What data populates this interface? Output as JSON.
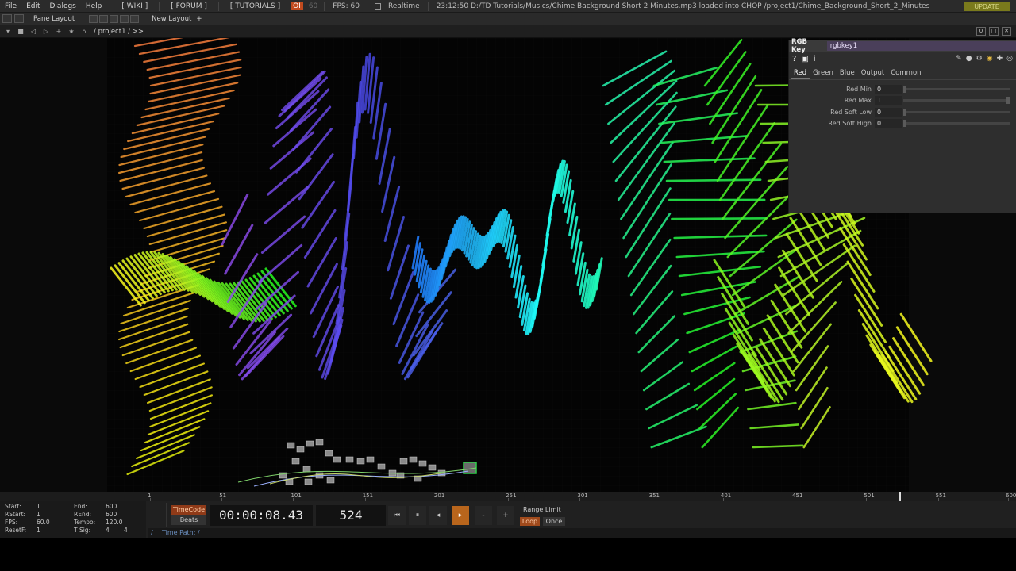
{
  "menubar": {
    "items": [
      "File",
      "Edit",
      "Dialogs",
      "Help"
    ],
    "links": [
      "[ WIKI ]",
      "[ FORUM ]",
      "[ TUTORIALS ]"
    ],
    "oi": "OI",
    "fps_dim": "60",
    "fps": "FPS:  60",
    "realtime": "Realtime",
    "status": "23:12:50 D:/TD Tutorials/Musics/Chime Background Short 2 Minutes.mp3 loaded into CHOP /project1/Chime_Background_Short_2_Minutes",
    "update": "UPDATE"
  },
  "panebar": {
    "pane_layout": "Pane Layout",
    "new_layout": "New Layout",
    "plus": "+"
  },
  "pathbar": {
    "path": "/ project1 / >>",
    "right_btn": "0"
  },
  "rgbkey": {
    "type": "RGB Key",
    "name": "rgbkey1",
    "help": "?",
    "info": "i",
    "tabs": [
      "Red",
      "Green",
      "Blue",
      "Output",
      "Common"
    ],
    "params": [
      {
        "label": "Red Min",
        "value": "0",
        "level": 0.0
      },
      {
        "label": "Red Max",
        "value": "1",
        "level": 1.0
      },
      {
        "label": "Red Soft Low",
        "value": "0",
        "level": 0.0
      },
      {
        "label": "Red Soft High",
        "value": "0",
        "level": 0.0
      }
    ]
  },
  "timeline": {
    "ticks": [
      "1",
      "51",
      "101",
      "151",
      "201",
      "251",
      "301",
      "351",
      "401",
      "451",
      "501",
      "551",
      "600"
    ],
    "current": 524
  },
  "info": {
    "start_label": "Start:",
    "start": "1",
    "end_label": "End:",
    "end": "600",
    "rstart_label": "RStart:",
    "rstart": "1",
    "rend_label": "REnd:",
    "rend": "600",
    "fps_label": "FPS:",
    "fps": "60.0",
    "tempo_label": "Tempo:",
    "tempo": "120.0",
    "resetf_label": "ResetF:",
    "resetf": "1",
    "tsig_label": "T Sig:",
    "tsig_a": "4",
    "tsig_b": "4"
  },
  "transport": {
    "timecode": "TimeCode",
    "beats": "Beats",
    "clock": "00:00:08.43",
    "frame": "524",
    "btn_start": "⏮",
    "btn_pause": "⏸",
    "btn_back": "◂",
    "btn_play": "▸",
    "btn_minus": "-",
    "btn_plus": "+",
    "range_limit": "Range Limit",
    "loop": "Loop",
    "once": "Once"
  },
  "timepath": {
    "slash": "/",
    "label": "Time Path: /"
  },
  "colors": {
    "accent_orange": "#b8651c",
    "param_name_bg": "#4a3f5a",
    "update_bg": "#7a7a1c"
  }
}
